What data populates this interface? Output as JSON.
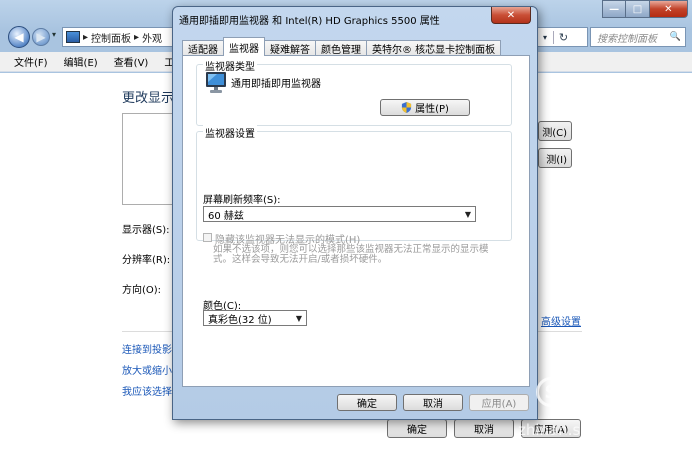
{
  "background_window": {
    "caption": {
      "min": "—",
      "max": "□",
      "close": "✕"
    },
    "nav": {
      "back": "◀",
      "forward": "▶",
      "history": "▾"
    },
    "address": {
      "sep1": "▸",
      "crumb1": "控制面板",
      "sep2": "▸",
      "crumb2": "外观",
      "dropdown": "▾",
      "refresh": "↻"
    },
    "search": {
      "placeholder": "搜索控制面板",
      "icon": "🔍"
    },
    "menu": [
      "文件(F)",
      "编辑(E)",
      "查看(V)",
      "工具(T)"
    ],
    "heading": "更改显示",
    "labels": {
      "display": "显示器(S):",
      "resolution": "分辨率(R):",
      "orientation": "方向(O):"
    },
    "side_buttons": [
      "测(C)",
      "测(I)"
    ],
    "advanced_link": "高级设置",
    "links": [
      "连接到投影仪",
      "放大或缩小文",
      "我应该选择什"
    ],
    "footer_buttons": {
      "ok": "确定",
      "cancel": "取消",
      "apply": "应用(A)"
    }
  },
  "dialog": {
    "title": "通用即插即用监视器 和 Intel(R) HD Graphics 5500 属性",
    "close": "✕",
    "tabs": [
      "适配器",
      "监视器",
      "疑难解答",
      "颜色管理",
      "英特尔® 核芯显卡控制面板"
    ],
    "active_tab": 1,
    "monitor_type": {
      "legend": "监视器类型",
      "name": "通用即插即用监视器",
      "properties_button": "属性(P)"
    },
    "monitor_settings": {
      "legend": "监视器设置",
      "refresh_label": "屏幕刷新频率(S):",
      "refresh_value": "60 赫兹",
      "combo_arrow": "▼",
      "hide_modes_label": "隐藏该监视器无法显示的模式(H)",
      "hide_modes_checked": false,
      "hide_modes_desc": "如果不选该项，则您可以选择那些该监视器无法正常显示的显示模式。这样会导致无法开启/或者损坏硬件。"
    },
    "color": {
      "label": "颜色(C):",
      "value": "真彩色(32 位)",
      "arrow": "▼"
    },
    "buttons": {
      "ok": "确定",
      "cancel": "取消",
      "apply": "应用(A)"
    }
  },
  "watermark": {
    "logo": "S",
    "main": "搜狗指南",
    "sub": "zhinan.sogou.com"
  }
}
